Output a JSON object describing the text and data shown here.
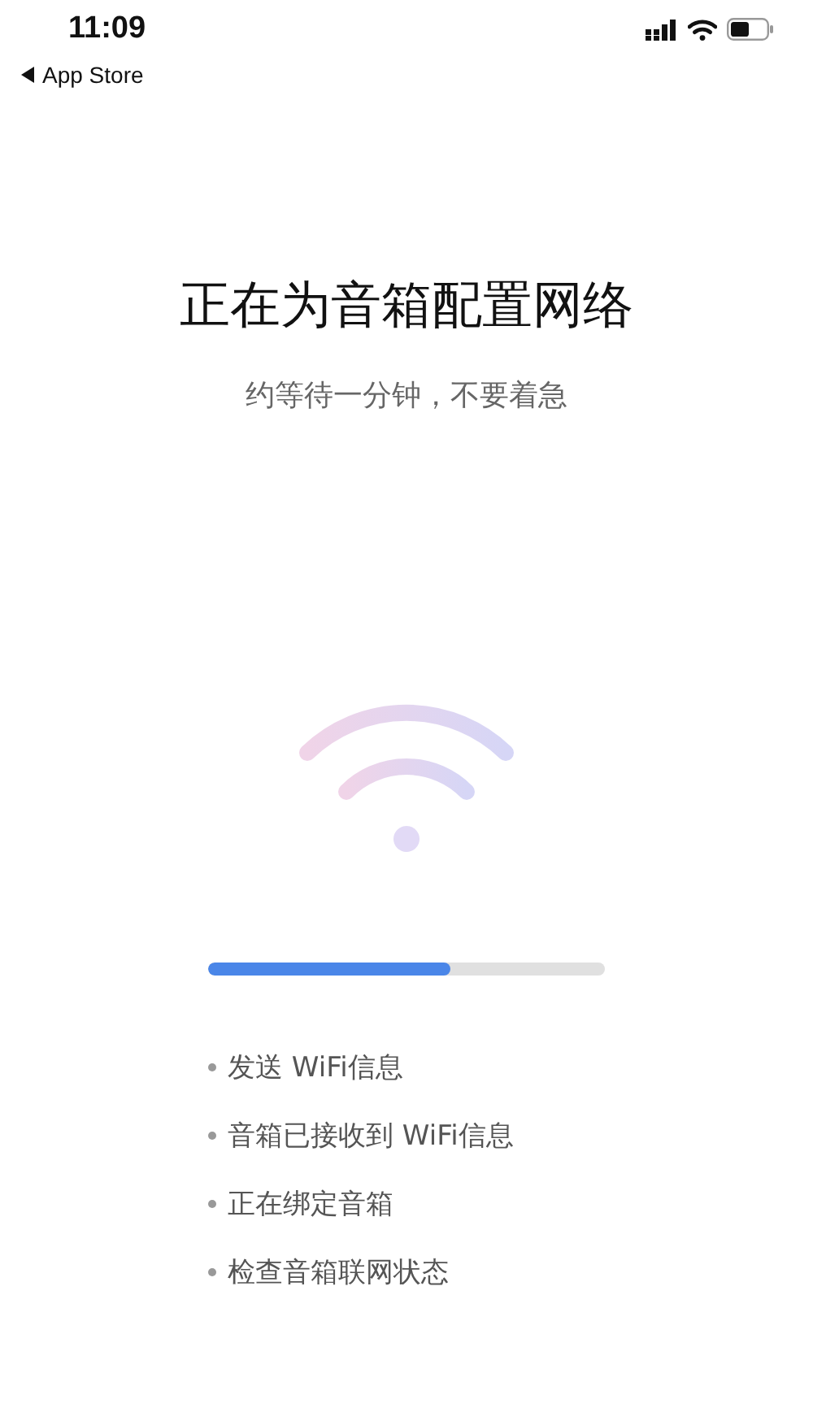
{
  "status_bar": {
    "time": "11:09",
    "back_label": "App Store"
  },
  "title": "正在为音箱配置网络",
  "subtitle": "约等待一分钟，不要着急",
  "progress": {
    "level": 0.61
  },
  "steps": [
    {
      "label": "发送 WiFi信息"
    },
    {
      "label": "音箱已接收到 WiFi信息"
    },
    {
      "label": "正在绑定音箱"
    },
    {
      "label": "检查音箱联网状态"
    }
  ]
}
